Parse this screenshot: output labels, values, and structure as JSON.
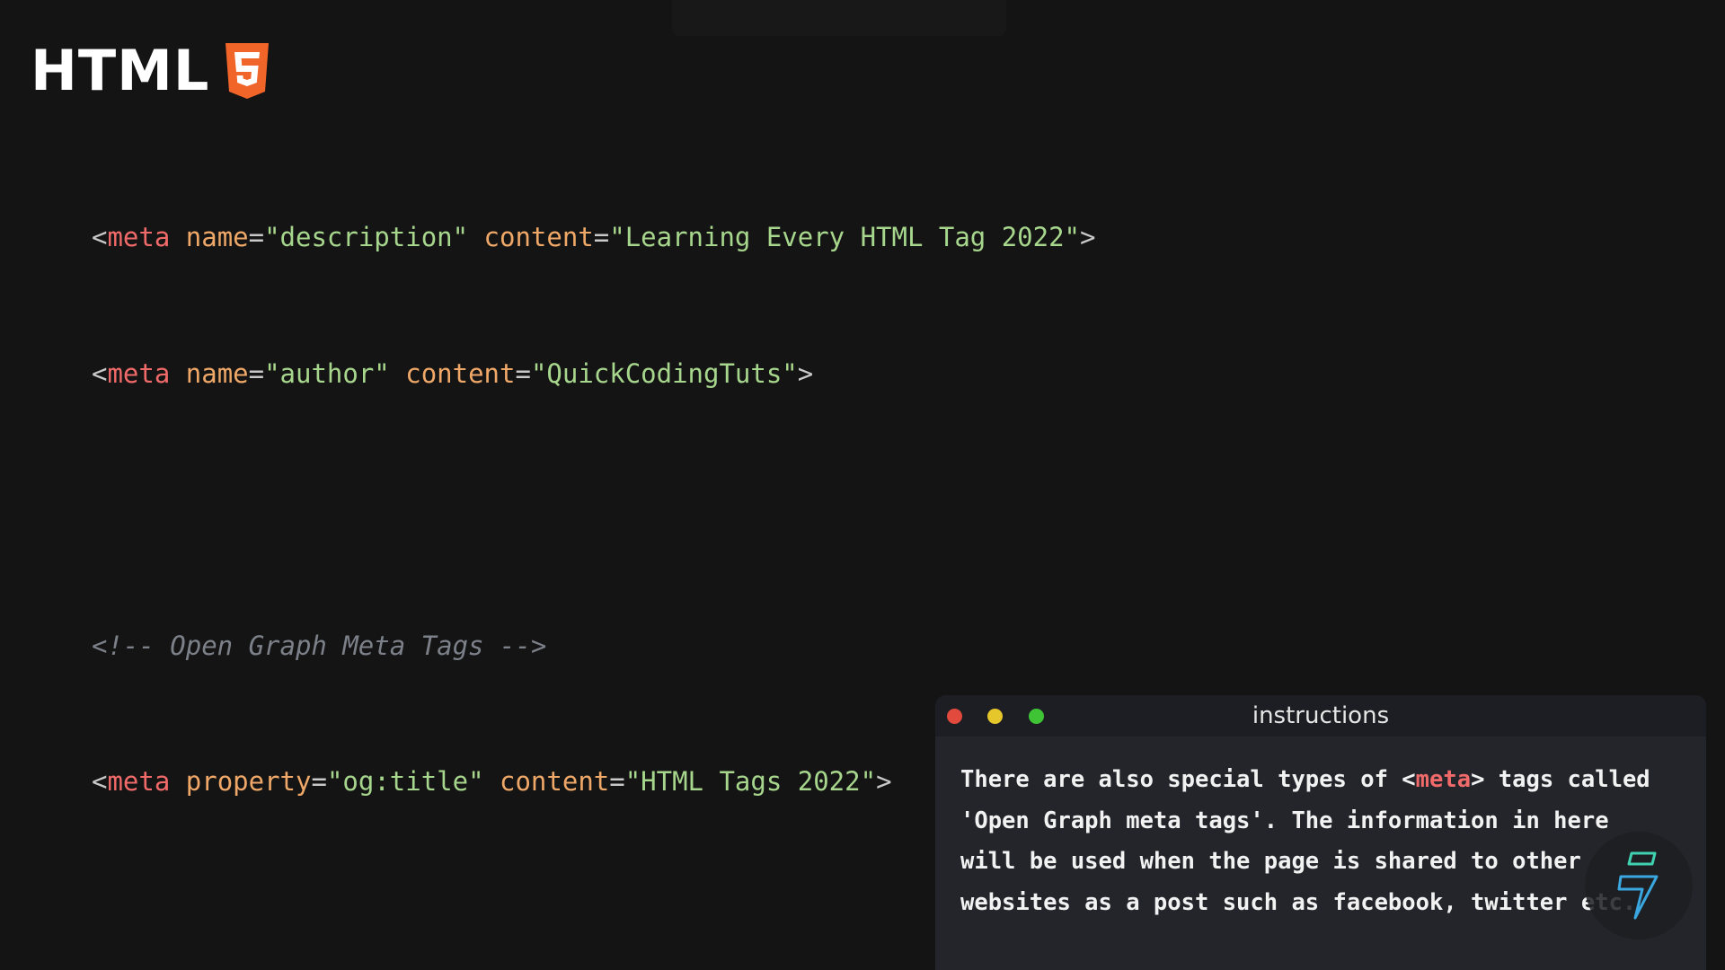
{
  "brand": {
    "title": "HTML",
    "logo_icon": "html5-shield-icon",
    "logo_color": "#f16529"
  },
  "code": {
    "line1": {
      "open": "<",
      "tag": "meta",
      "attr1": "name",
      "eq1": "=",
      "val1": "\"description\"",
      "attr2": "content",
      "eq2": "=",
      "val2": "\"Learning Every HTML Tag 2022\"",
      "close": ">"
    },
    "line2": {
      "open": "<",
      "tag": "meta",
      "attr1": "name",
      "eq1": "=",
      "val1": "\"author\"",
      "attr2": "content",
      "eq2": "=",
      "val2": "\"QuickCodingTuts\"",
      "close": ">"
    },
    "comment": "<!-- Open Graph Meta Tags -->",
    "line4": {
      "open": "<",
      "tag": "meta",
      "attr1": "property",
      "eq1": "=",
      "val1": "\"og:title\"",
      "attr2": "content",
      "eq2": "=",
      "val2": "\"HTML Tags 2022\"",
      "close": ">"
    },
    "colors": {
      "tag": "#f06a6a",
      "attribute": "#f0a868",
      "string": "#a7d68d",
      "comment": "#7c8089",
      "punctuation": "#c9c9c9"
    }
  },
  "panel": {
    "title": "instructions",
    "window_controls": [
      "close-dot",
      "minimize-dot",
      "maximize-dot"
    ],
    "text": {
      "l1a": "There are also special types of ",
      "l1b": "<",
      "l1tag": "meta",
      "l1c": ">",
      "l1d": " tags called",
      "l2": "'Open Graph meta tags'. The information in here",
      "l3": "will be used when the page is shared to other",
      "l4": "websites as a post such as facebook, twitter etc."
    }
  },
  "watermark": {
    "icon": "lightning-bolt-logo-icon"
  }
}
